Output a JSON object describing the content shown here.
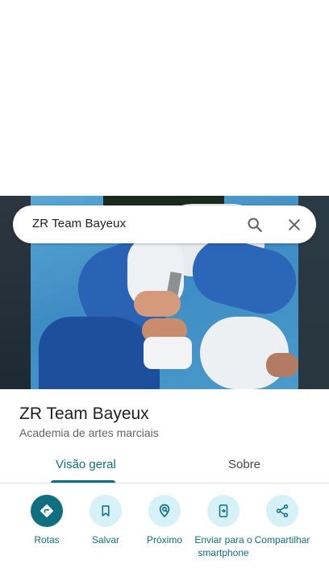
{
  "search": {
    "query": "ZR Team Bayeux"
  },
  "place": {
    "name": "ZR Team Bayeux",
    "category": "Academia de artes marciais"
  },
  "tabs": [
    {
      "label": "Visão geral",
      "active": true
    },
    {
      "label": "Sobre",
      "active": false
    }
  ],
  "actions": [
    {
      "label": "Rotas",
      "icon": "directions-icon",
      "primary": true
    },
    {
      "label": "Salvar",
      "icon": "bookmark-icon",
      "primary": false
    },
    {
      "label": "Próximo",
      "icon": "nearby-icon",
      "primary": false
    },
    {
      "label": "Enviar para o smartphone",
      "icon": "send-to-phone-icon",
      "primary": false
    },
    {
      "label": "Compartilhar",
      "icon": "share-icon",
      "primary": false
    }
  ],
  "colors": {
    "accent": "#0f6f80",
    "accent_light": "#d6f1f7",
    "text_primary": "#202124",
    "text_secondary": "#5f6368"
  }
}
